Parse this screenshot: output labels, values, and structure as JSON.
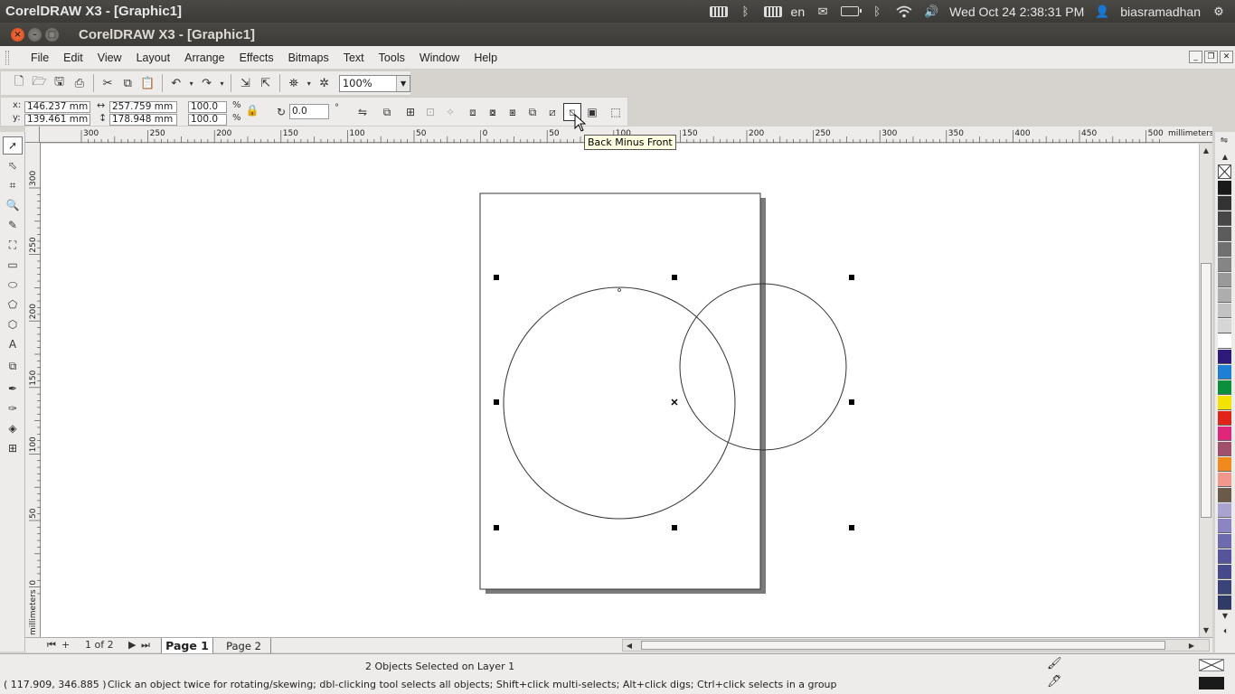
{
  "system_panel": {
    "app_title": "CorelDRAW X3 - [Graphic1]",
    "keyboard_layout": "en",
    "datetime": "Wed Oct 24  2:38:31 PM",
    "username": "biasramadhan"
  },
  "window": {
    "title": "CorelDRAW X3 - [Graphic1]"
  },
  "menu": {
    "items": [
      "File",
      "Edit",
      "View",
      "Layout",
      "Arrange",
      "Effects",
      "Bitmaps",
      "Text",
      "Tools",
      "Window",
      "Help"
    ]
  },
  "standard_toolbar": {
    "zoom_level": "100%"
  },
  "property_bar": {
    "x_label": "x:",
    "y_label": "y:",
    "x_value": "146.237 mm",
    "y_value": "139.461 mm",
    "width_value": "257.759 mm",
    "height_value": "178.948 mm",
    "scale_x": "100.0",
    "scale_y": "100.0",
    "percent_symbol": "%",
    "rotation_value": "0.0",
    "degree_symbol": "°"
  },
  "tooltip": {
    "text": "Back Minus Front"
  },
  "ruler": {
    "unit": "millimeters",
    "h_ticks": [
      "300",
      "250",
      "200",
      "150",
      "100",
      "50",
      "0",
      "50",
      "100",
      "150",
      "200",
      "250",
      "300",
      "350",
      "400",
      "450",
      "500"
    ],
    "v_ticks": [
      "300",
      "250",
      "200",
      "150",
      "100",
      "50",
      "0"
    ],
    "v_unit": "millimeters"
  },
  "pages": {
    "counter": "1 of 2",
    "tabs": [
      "Page 1",
      "Page 2"
    ],
    "active": "Page 1"
  },
  "status": {
    "selection": "2 Objects Selected on Layer 1",
    "coords": "( 117.909, 346.885 )",
    "hint": "Click an object twice for rotating/skewing; dbl-clicking tool selects all objects; Shift+click multi-selects; Alt+click digs; Ctrl+click selects in a group"
  },
  "palette": {
    "colors": [
      "#1a1a1a",
      "#333333",
      "#474747",
      "#5c5c5c",
      "#707070",
      "#858585",
      "#999999",
      "#adadad",
      "#c2c2c2",
      "#d6d6d6",
      "#ffffff",
      "#2e1a7a",
      "#1e7fd4",
      "#0a8f3c",
      "#f2e400",
      "#e2231a",
      "#e0267a",
      "#a0506c",
      "#f08a1c",
      "#f0988c",
      "#6b5a4a",
      "#a9a3d0",
      "#8b86c2",
      "#6e6aae",
      "#56559c",
      "#46498a",
      "#3a4478",
      "#2f3a66"
    ]
  }
}
